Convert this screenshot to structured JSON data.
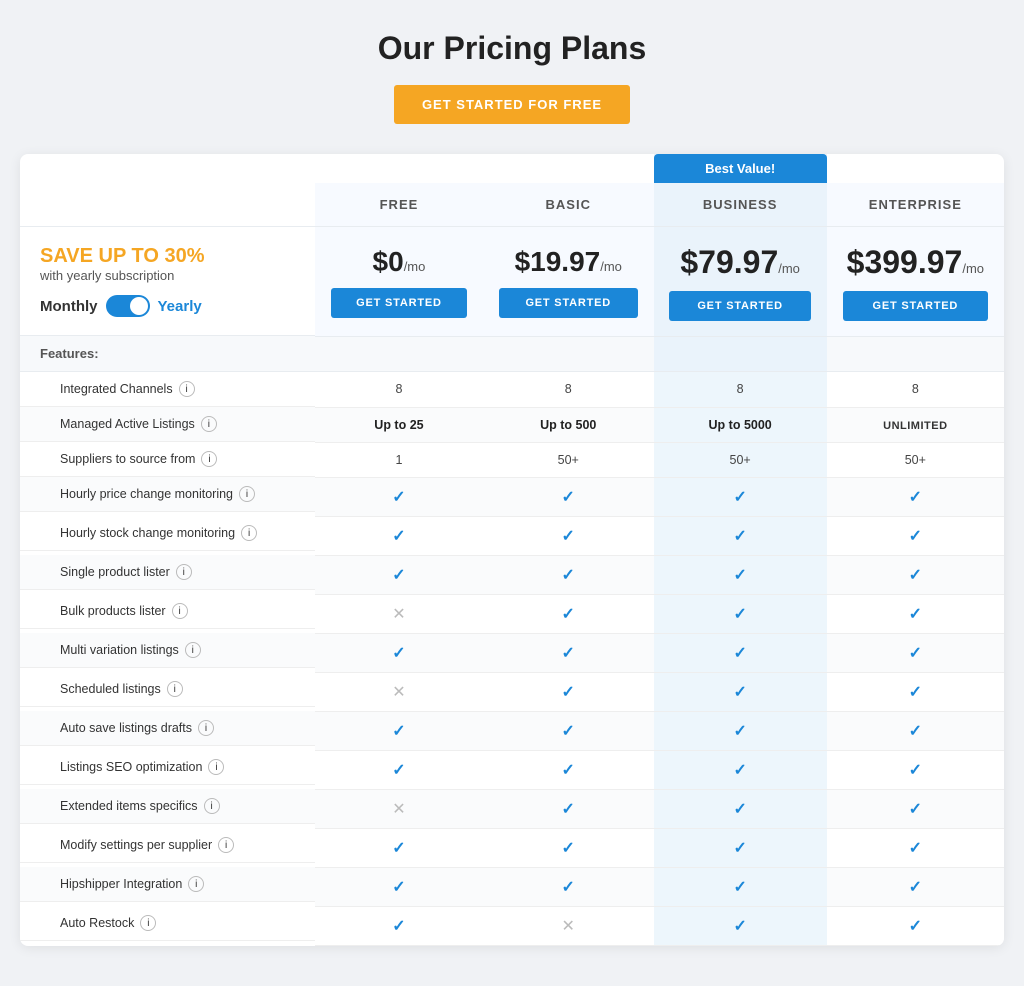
{
  "page": {
    "title": "Our Pricing Plans",
    "cta_button": "GET STARTED FOR FREE",
    "save_text": "SAVE UP TO 30%",
    "yearly_sub_text": "with yearly subscription",
    "toggle_monthly": "Monthly",
    "toggle_yearly": "Yearly",
    "best_value_label": "Best Value!",
    "features_header": "Features:",
    "plans": [
      {
        "id": "free",
        "name": "FREE",
        "price": "$0",
        "per": "/mo",
        "button": "GET STARTED"
      },
      {
        "id": "basic",
        "name": "BASIC",
        "price": "$19.97",
        "per": "/mo",
        "button": "GET STARTED"
      },
      {
        "id": "business",
        "name": "BUSINESS",
        "price": "$79.97",
        "per": "/mo",
        "button": "GET STARTED",
        "best_value": true
      },
      {
        "id": "enterprise",
        "name": "ENTERPRISE",
        "price": "$399.97",
        "per": "/mo",
        "button": "GET STARTED"
      }
    ],
    "features": [
      {
        "label": "Integrated Channels",
        "values": [
          "8",
          "8",
          "8",
          "8"
        ],
        "types": [
          "text",
          "text",
          "text",
          "text"
        ]
      },
      {
        "label": "Managed Active Listings",
        "values": [
          "Up to 25",
          "Up to 500",
          "Up to 5000",
          "UNLIMITED"
        ],
        "types": [
          "bold",
          "bold",
          "bold",
          "unlimited"
        ]
      },
      {
        "label": "Suppliers to source from",
        "values": [
          "1",
          "50+",
          "50+",
          "50+"
        ],
        "types": [
          "text",
          "text",
          "text",
          "text"
        ]
      },
      {
        "label": "Hourly price change monitoring",
        "values": [
          "check",
          "check",
          "check",
          "check"
        ],
        "types": [
          "check",
          "check",
          "check",
          "check"
        ]
      },
      {
        "label": "Hourly stock change monitoring",
        "values": [
          "check",
          "check",
          "check",
          "check"
        ],
        "types": [
          "check",
          "check",
          "check",
          "check"
        ]
      },
      {
        "label": "Single product lister",
        "values": [
          "check",
          "check",
          "check",
          "check"
        ],
        "types": [
          "check",
          "check",
          "check",
          "check"
        ]
      },
      {
        "label": "Bulk products lister",
        "values": [
          "cross",
          "check",
          "check",
          "check"
        ],
        "types": [
          "cross",
          "check",
          "check",
          "check"
        ]
      },
      {
        "label": "Multi variation listings",
        "values": [
          "check",
          "check",
          "check",
          "check"
        ],
        "types": [
          "check",
          "check",
          "check",
          "check"
        ]
      },
      {
        "label": "Scheduled listings",
        "values": [
          "cross",
          "check",
          "check",
          "check"
        ],
        "types": [
          "cross",
          "check",
          "check",
          "check"
        ]
      },
      {
        "label": "Auto save listings drafts",
        "values": [
          "check",
          "check",
          "check",
          "check"
        ],
        "types": [
          "check",
          "check",
          "check",
          "check"
        ]
      },
      {
        "label": "Listings SEO optimization",
        "values": [
          "check",
          "check",
          "check",
          "check"
        ],
        "types": [
          "check",
          "check",
          "check",
          "check"
        ]
      },
      {
        "label": "Extended items specifics",
        "values": [
          "cross",
          "check",
          "check",
          "check"
        ],
        "types": [
          "cross",
          "check",
          "check",
          "check"
        ]
      },
      {
        "label": "Modify settings per supplier",
        "values": [
          "check",
          "check",
          "check",
          "check"
        ],
        "types": [
          "check",
          "check",
          "check",
          "check"
        ]
      },
      {
        "label": "Hipshipper Integration",
        "values": [
          "check",
          "check",
          "check",
          "check"
        ],
        "types": [
          "check",
          "check",
          "check",
          "check"
        ]
      },
      {
        "label": "Auto Restock",
        "values": [
          "check",
          "cross",
          "check",
          "check"
        ],
        "types": [
          "check",
          "cross",
          "check",
          "check"
        ]
      }
    ]
  }
}
